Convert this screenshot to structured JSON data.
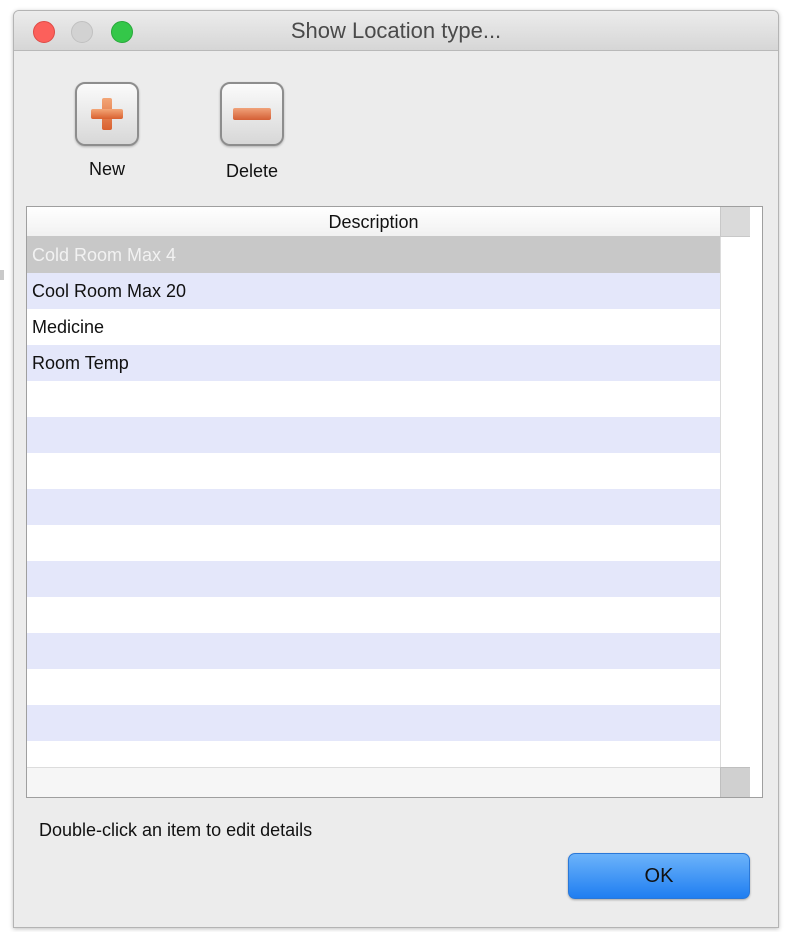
{
  "window": {
    "title": "Show Location type..."
  },
  "toolbar": {
    "new_label": "New",
    "delete_label": "Delete",
    "new_icon": "plus-icon",
    "delete_icon": "minus-icon",
    "icon_color": "#e06a35"
  },
  "table": {
    "columns": [
      "Description"
    ],
    "rows": [
      {
        "description": "Cold Room Max 4",
        "selected": true
      },
      {
        "description": "Cool Room Max 20",
        "selected": false
      },
      {
        "description": "Medicine",
        "selected": false
      },
      {
        "description": "Room Temp",
        "selected": false
      }
    ]
  },
  "footer": {
    "hint": "Double-click an item to edit details",
    "ok_label": "OK"
  },
  "colors": {
    "row_stripe": "#e4e7fa",
    "selection": "#c8c8c8",
    "ok_button": "#2f8cf4",
    "close_light": "#fc605b",
    "max_light": "#34c749"
  }
}
